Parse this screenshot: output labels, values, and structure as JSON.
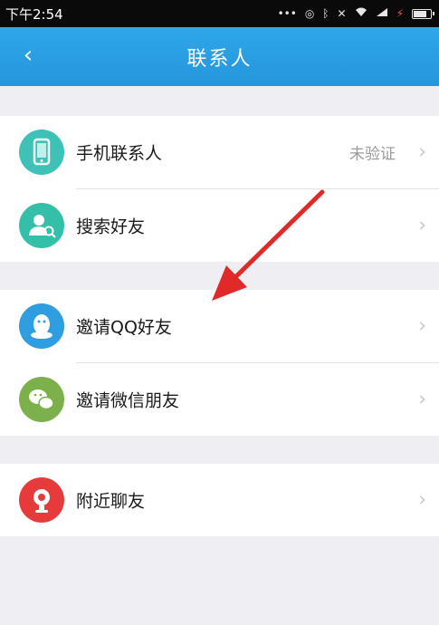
{
  "status_bar": {
    "time": "下午2:54",
    "icons": [
      "more-dots-icon",
      "alarm-icon",
      "bluetooth-icon",
      "mute-icon",
      "wifi-icon",
      "signal-icon",
      "battery-icon"
    ]
  },
  "header": {
    "back_label": "‹",
    "title": "联系人"
  },
  "colors": {
    "title_bar": "#2596dc",
    "phone_contacts_icon": "#3ec1b6",
    "search_friends_icon": "#33bfa8",
    "invite_qq_icon": "#2f9ee0",
    "invite_wechat_icon": "#7bb04a",
    "nearby_icon": "#e63b3b",
    "annotation_arrow": "#e02a2a"
  },
  "groups": [
    {
      "items": [
        {
          "label": "手机联系人",
          "status": "未验证",
          "icon": "phone-contacts-icon"
        },
        {
          "label": "搜索好友",
          "status": "",
          "icon": "search-friends-icon"
        }
      ]
    },
    {
      "items": [
        {
          "label": "邀请QQ好友",
          "status": "",
          "icon": "qq-penguin-icon"
        },
        {
          "label": "邀请微信朋友",
          "status": "",
          "icon": "wechat-icon"
        }
      ]
    },
    {
      "items": [
        {
          "label": "附近聊友",
          "status": "",
          "icon": "nearby-location-icon"
        }
      ]
    }
  ],
  "chevron": "›"
}
